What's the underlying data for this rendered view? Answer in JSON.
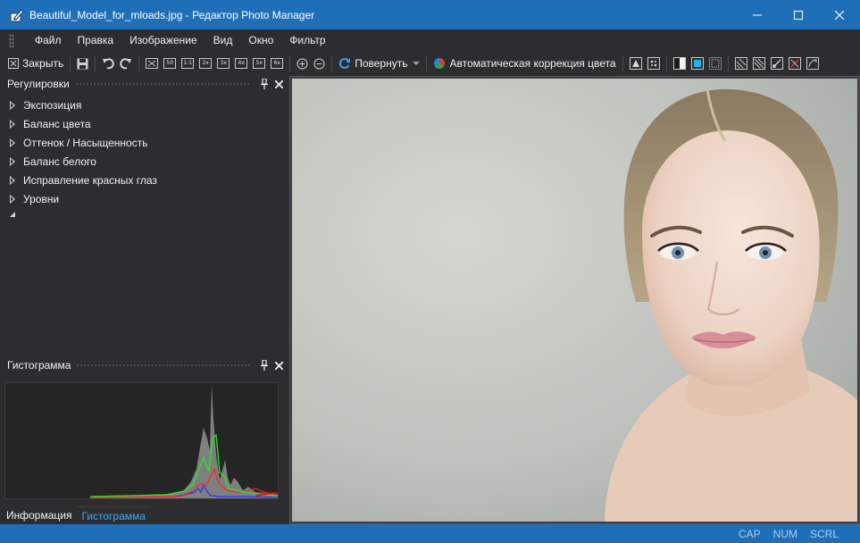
{
  "window": {
    "title": "Beautiful_Model_for_mloads.jpg - Редактор Photo Manager"
  },
  "menu": [
    "Файл",
    "Правка",
    "Изображение",
    "Вид",
    "Окно",
    "Фильтр"
  ],
  "toolbar": {
    "close_label": "Закрыть",
    "zoom_labels": [
      "50",
      "1:1",
      "2x",
      "3x",
      "4x",
      "5x",
      "6x"
    ],
    "rotate_label": "Повернуть",
    "autocolor_label": "Автоматическая коррекция цвета"
  },
  "adjustments_panel": {
    "title": "Регулировки",
    "items": [
      "Экспозиция",
      "Баланс цвета",
      "Оттенок / Насыщенность",
      "Баланс белого",
      "Исправление красных глаз",
      "Уровни"
    ]
  },
  "histogram_panel": {
    "title": "Гистограмма"
  },
  "bottom_tabs": [
    "Информация",
    "Гистограмма"
  ],
  "status": [
    "CAP",
    "NUM",
    "SCRL"
  ],
  "colors": {
    "accent": "#1f6fb8",
    "background": "#2d2d30",
    "active_tab_text": "#3fa8f4"
  }
}
